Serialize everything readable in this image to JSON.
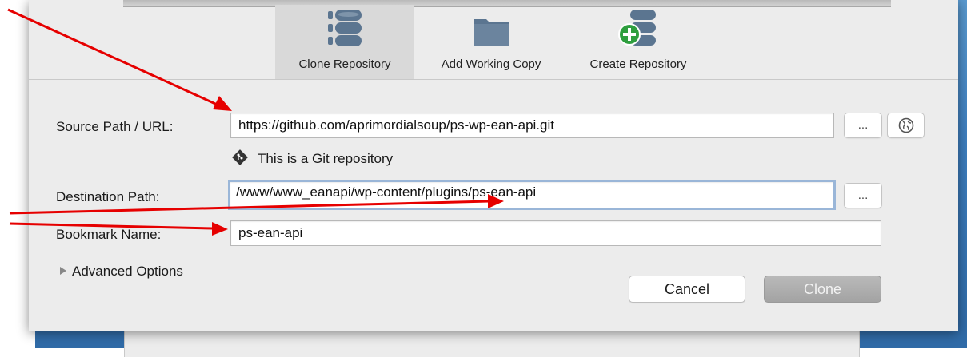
{
  "toolbar": {
    "items": [
      {
        "label": "Clone Repository",
        "icon": "database-stack-icon",
        "selected": true
      },
      {
        "label": "Add Working Copy",
        "icon": "folder-icon",
        "selected": false
      },
      {
        "label": "Create Repository",
        "icon": "database-add-icon",
        "selected": false
      }
    ]
  },
  "form": {
    "source": {
      "label": "Source Path / URL:",
      "value": "https://github.com/aprimordialsoup/ps-wp-ean-api.git"
    },
    "git_note": "This is a Git repository",
    "destination": {
      "label": "Destination Path:",
      "value": "/www/www_eanapi/wp-content/plugins/ps-ean-api"
    },
    "bookmark": {
      "label": "Bookmark Name:",
      "value": "ps-ean-api"
    },
    "browse_label": "...",
    "remote_icon": "globe-icon",
    "advanced_label": "Advanced Options"
  },
  "buttons": {
    "cancel": "Cancel",
    "clone": "Clone"
  },
  "colors": {
    "arrow": "#e60000",
    "icon_slate": "#5b7590",
    "icon_green": "#2e9e3e",
    "focus_ring": "#9ab6d8"
  }
}
